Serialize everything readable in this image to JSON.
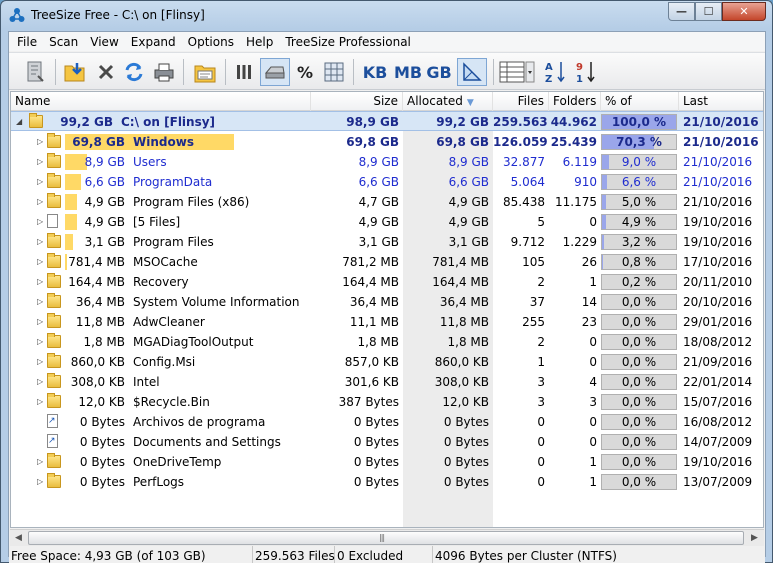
{
  "window": {
    "title": "TreeSize Free - C:\\  on  [Flinsy]",
    "controls": [
      "minimize",
      "maximize",
      "close"
    ]
  },
  "menu": [
    "File",
    "Scan",
    "View",
    "Expand",
    "Options",
    "Help",
    "TreeSize Professional"
  ],
  "toolbar": {
    "unit_labels": [
      "KB",
      "MB",
      "GB"
    ],
    "percent_label": "%",
    "icons": [
      "scan-options-icon",
      "select-folder-icon",
      "stop-icon",
      "refresh-icon",
      "print-icon",
      "export-icon",
      "bar-view-icon",
      "size-view-icon",
      "percent-icon",
      "grid-view-icon",
      "auto-unit-icon",
      "columns-icon",
      "sort-az-icon",
      "sort-size-icon"
    ]
  },
  "columns": {
    "name": "Name",
    "size": "Size",
    "allocated": "Allocated",
    "files": "Files",
    "folders": "Folders",
    "percent": "% of Paren...",
    "modified": "Last Modified"
  },
  "root": {
    "size_label": "99,2 GB",
    "name": "C:\\  on  [Flinsy]",
    "size": "98,9 GB",
    "allocated": "99,2 GB",
    "files": "259.563",
    "folders": "44.962",
    "percent": "100,0 %",
    "percent_value": 100,
    "modified": "21/10/2016"
  },
  "rows": [
    {
      "size_label": "69,8 GB",
      "name": "Windows",
      "size": "69,8 GB",
      "allocated": "69,8 GB",
      "files": "126.059",
      "folders": "25.439",
      "percent": "70,3 %",
      "percent_value": 70.3,
      "modified": "21/10/2016",
      "icon": "folder",
      "style": "bold-navy",
      "bar": 70.3
    },
    {
      "size_label": "8,9 GB",
      "name": "Users",
      "size": "8,9 GB",
      "allocated": "8,9 GB",
      "files": "32.877",
      "folders": "6.119",
      "percent": "9,0 %",
      "percent_value": 9.0,
      "modified": "21/10/2016",
      "icon": "folder",
      "style": "blue",
      "bar": 9.0
    },
    {
      "size_label": "6,6 GB",
      "name": "ProgramData",
      "size": "6,6 GB",
      "allocated": "6,6 GB",
      "files": "5.064",
      "folders": "910",
      "percent": "6,6 %",
      "percent_value": 6.6,
      "modified": "21/10/2016",
      "icon": "folder",
      "style": "blue",
      "bar": 6.6
    },
    {
      "size_label": "4,9 GB",
      "name": "Program Files (x86)",
      "size": "4,7 GB",
      "allocated": "4,9 GB",
      "files": "85.438",
      "folders": "11.175",
      "percent": "5,0 %",
      "percent_value": 5.0,
      "modified": "21/10/2016",
      "icon": "folder",
      "style": "normal",
      "bar": 5.0
    },
    {
      "size_label": "4,9 GB",
      "name": "[5 Files]",
      "size": "4,9 GB",
      "allocated": "4,9 GB",
      "files": "5",
      "folders": "0",
      "percent": "4,9 %",
      "percent_value": 4.9,
      "modified": "19/10/2016",
      "icon": "file",
      "style": "normal",
      "bar": 4.9
    },
    {
      "size_label": "3,1 GB",
      "name": "Program Files",
      "size": "3,1 GB",
      "allocated": "3,1 GB",
      "files": "9.712",
      "folders": "1.229",
      "percent": "3,2 %",
      "percent_value": 3.2,
      "modified": "19/10/2016",
      "icon": "folder",
      "style": "normal",
      "bar": 3.2
    },
    {
      "size_label": "781,4 MB",
      "name": "MSOCache",
      "size": "781,2 MB",
      "allocated": "781,4 MB",
      "files": "105",
      "folders": "26",
      "percent": "0,8 %",
      "percent_value": 0.8,
      "modified": "17/10/2016",
      "icon": "folder",
      "style": "normal",
      "bar": 0.8
    },
    {
      "size_label": "164,4 MB",
      "name": "Recovery",
      "size": "164,4 MB",
      "allocated": "164,4 MB",
      "files": "2",
      "folders": "1",
      "percent": "0,2 %",
      "percent_value": 0.2,
      "modified": "20/11/2010",
      "icon": "folder",
      "style": "normal",
      "bar": 0.2
    },
    {
      "size_label": "36,4 MB",
      "name": "System Volume Information",
      "size": "36,4 MB",
      "allocated": "36,4 MB",
      "files": "37",
      "folders": "14",
      "percent": "0,0 %",
      "percent_value": 0,
      "modified": "20/10/2016",
      "icon": "folder",
      "style": "normal",
      "bar": 0
    },
    {
      "size_label": "11,8 MB",
      "name": "AdwCleaner",
      "size": "11,1 MB",
      "allocated": "11,8 MB",
      "files": "255",
      "folders": "23",
      "percent": "0,0 %",
      "percent_value": 0,
      "modified": "29/01/2016",
      "icon": "folder",
      "style": "normal",
      "bar": 0
    },
    {
      "size_label": "1,8 MB",
      "name": "MGADiagToolOutput",
      "size": "1,8 MB",
      "allocated": "1,8 MB",
      "files": "2",
      "folders": "0",
      "percent": "0,0 %",
      "percent_value": 0,
      "modified": "18/08/2012",
      "icon": "folder",
      "style": "normal",
      "bar": 0
    },
    {
      "size_label": "860,0 KB",
      "name": "Config.Msi",
      "size": "857,0 KB",
      "allocated": "860,0 KB",
      "files": "1",
      "folders": "0",
      "percent": "0,0 %",
      "percent_value": 0,
      "modified": "21/09/2016",
      "icon": "folder",
      "style": "normal",
      "bar": 0
    },
    {
      "size_label": "308,0 KB",
      "name": "Intel",
      "size": "301,6 KB",
      "allocated": "308,0 KB",
      "files": "3",
      "folders": "4",
      "percent": "0,0 %",
      "percent_value": 0,
      "modified": "22/01/2014",
      "icon": "folder",
      "style": "normal",
      "bar": 0
    },
    {
      "size_label": "12,0 KB",
      "name": "$Recycle.Bin",
      "size": "387 Bytes",
      "allocated": "12,0 KB",
      "files": "3",
      "folders": "3",
      "percent": "0,0 %",
      "percent_value": 0,
      "modified": "15/07/2016",
      "icon": "folder",
      "style": "normal",
      "bar": 0
    },
    {
      "size_label": "0 Bytes",
      "name": "Archivos de programa",
      "size": "0 Bytes",
      "allocated": "0 Bytes",
      "files": "0",
      "folders": "0",
      "percent": "0,0 %",
      "percent_value": 0,
      "modified": "16/08/2012",
      "icon": "link",
      "style": "normal",
      "bar": 0
    },
    {
      "size_label": "0 Bytes",
      "name": "Documents and Settings",
      "size": "0 Bytes",
      "allocated": "0 Bytes",
      "files": "0",
      "folders": "0",
      "percent": "0,0 %",
      "percent_value": 0,
      "modified": "14/07/2009",
      "icon": "link",
      "style": "normal",
      "bar": 0
    },
    {
      "size_label": "0 Bytes",
      "name": "OneDriveTemp",
      "size": "0 Bytes",
      "allocated": "0 Bytes",
      "files": "0",
      "folders": "1",
      "percent": "0,0 %",
      "percent_value": 0,
      "modified": "19/10/2016",
      "icon": "folder",
      "style": "normal",
      "bar": 0
    },
    {
      "size_label": "0 Bytes",
      "name": "PerfLogs",
      "size": "0 Bytes",
      "allocated": "0 Bytes",
      "files": "0",
      "folders": "1",
      "percent": "0,0 %",
      "percent_value": 0,
      "modified": "13/07/2009",
      "icon": "folder",
      "style": "normal",
      "bar": 0
    }
  ],
  "status": {
    "free_space": "Free Space: 4,93 GB  (of 103 GB)",
    "files": "259.563  Files",
    "excluded": "0 Excluded",
    "cluster": "4096  Bytes per Cluster (NTFS)"
  },
  "colors": {
    "size_bar": "#ffd966",
    "percent_fill": "#9aa6ea",
    "link_blue": "#1f2ccf",
    "selection": "#d7e6f6"
  }
}
